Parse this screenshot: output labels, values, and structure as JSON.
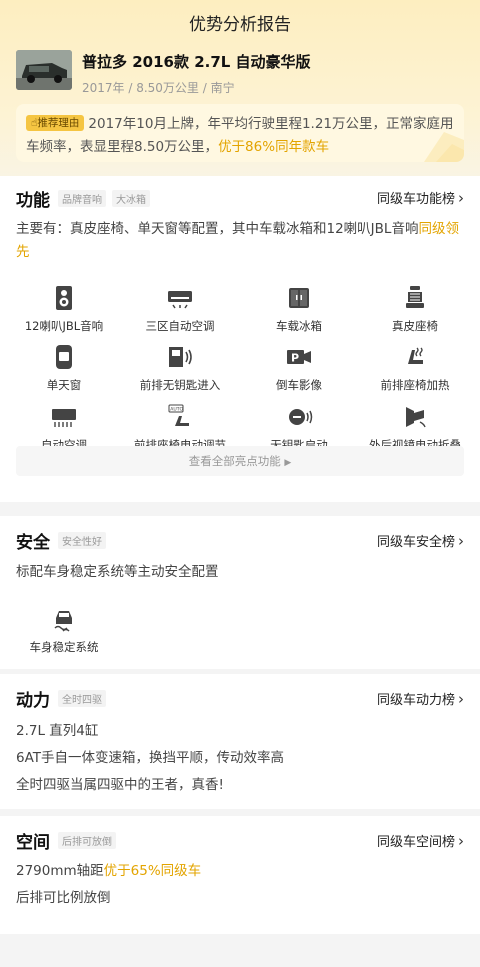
{
  "header": {
    "title": "优势分析报告"
  },
  "car": {
    "name": "普拉多 2016款 2.7L 自动豪华版",
    "sub": "2017年 / 8.50万公里 / 南宁"
  },
  "reason": {
    "tag": "推荐理由",
    "text_part1": "2017年10月上牌，年平均行驶里程1.21万公里，正常家庭用车频率，表显里程8.50万公里，",
    "text_highlight": "优于86%同年款车"
  },
  "features": {
    "title": "功能",
    "tags": [
      "品牌音响",
      "大冰箱"
    ],
    "rank_label": "同级车功能榜",
    "desc": "主要有：真皮座椅、单天窗等配置，其中车载冰箱和12喇叭JBL音响",
    "desc_highlight": "同级领先",
    "items": [
      {
        "label": "12喇叭JBL音响",
        "icon": "speaker-icon"
      },
      {
        "label": "三区自动空调",
        "icon": "ac-unit-icon"
      },
      {
        "label": "车载冰箱",
        "icon": "fridge-icon"
      },
      {
        "label": "真皮座椅",
        "icon": "seat-icon"
      },
      {
        "label": "单天窗",
        "icon": "sunroof-icon"
      },
      {
        "label": "前排无钥匙进入",
        "icon": "keyless-entry-icon"
      },
      {
        "label": "倒车影像",
        "icon": "reverse-camera-icon"
      },
      {
        "label": "前排座椅加热",
        "icon": "seat-heating-icon"
      },
      {
        "label": "自动空调",
        "icon": "auto-ac-icon"
      },
      {
        "label": "前排座椅电动调节",
        "icon": "power-seat-icon"
      },
      {
        "label": "无钥匙启动",
        "icon": "start-button-icon"
      },
      {
        "label": "外后视镜电动折叠",
        "icon": "mirror-fold-icon"
      }
    ],
    "view_all": "查看全部亮点功能"
  },
  "safety": {
    "title": "安全",
    "tag": "安全性好",
    "rank_label": "同级车安全榜",
    "desc": "标配车身稳定系统等主动安全配置",
    "items": [
      {
        "label": "车身稳定系统",
        "icon": "stability-control-icon"
      }
    ]
  },
  "power": {
    "title": "动力",
    "tag": "全时四驱",
    "rank_label": "同级车动力榜",
    "lines": [
      "2.7L 直列4缸",
      "6AT手自一体变速箱，换挡平顺，传动效率高",
      "全时四驱当属四驱中的王者，真香!"
    ]
  },
  "space": {
    "title": "空间",
    "tag": "后排可放倒",
    "rank_label": "同级车空间榜",
    "line1_a": "2790mm轴距",
    "line1_highlight": "优于65%同级车",
    "line2": "后排可比例放倒"
  },
  "colors": {
    "accent": "#e3a400",
    "tag_bg": "#f5c542"
  }
}
